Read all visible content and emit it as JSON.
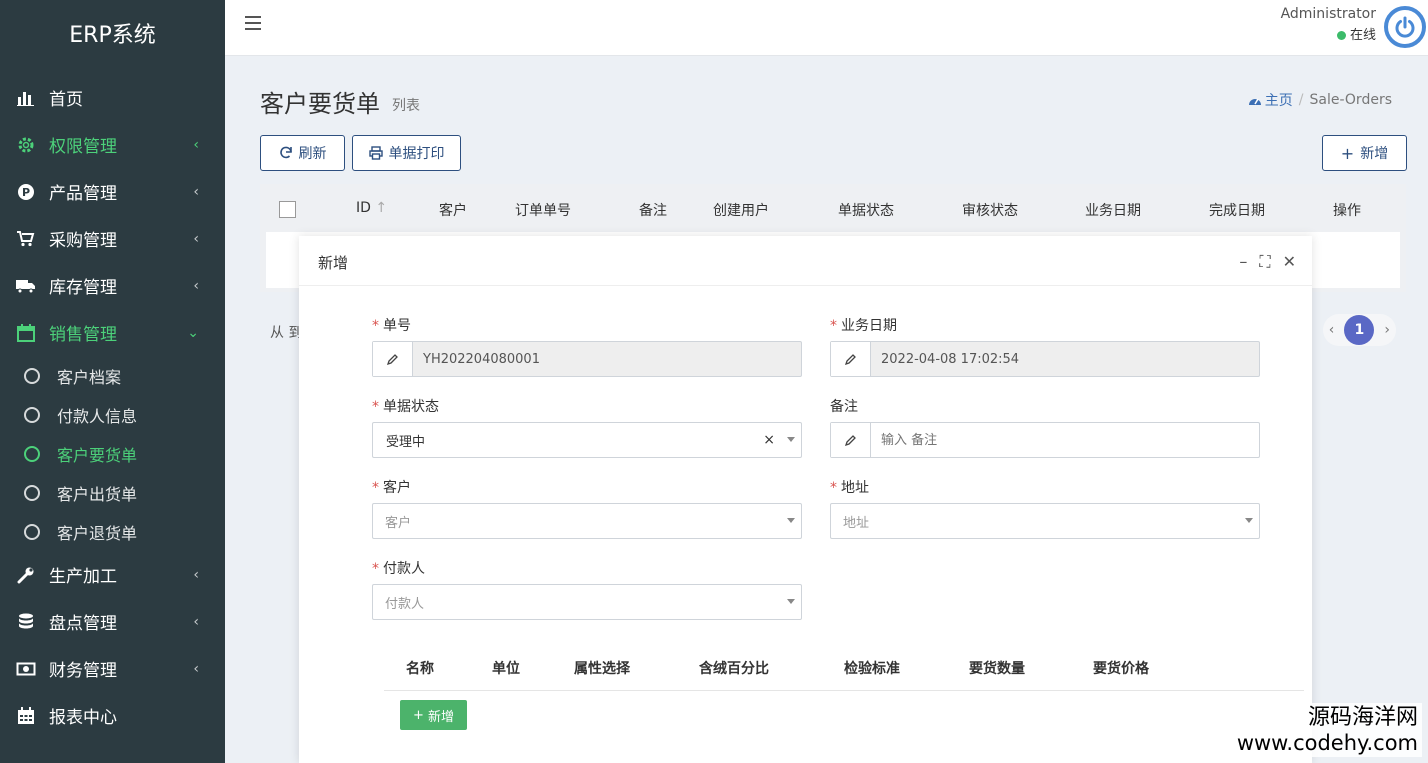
{
  "app": {
    "brand": "ERP系统"
  },
  "sidebar": {
    "items": [
      {
        "label": "首页",
        "icon": "bar-chart-icon",
        "active": false,
        "has_chevron": false
      },
      {
        "label": "权限管理",
        "icon": "gear-icon",
        "active": true,
        "has_chevron": true,
        "chevron": "‹"
      },
      {
        "label": "产品管理",
        "icon": "p-circle-icon",
        "active": false,
        "has_chevron": true,
        "chevron": "‹"
      },
      {
        "label": "采购管理",
        "icon": "cart-icon",
        "active": false,
        "has_chevron": true,
        "chevron": "‹"
      },
      {
        "label": "库存管理",
        "icon": "truck-icon",
        "active": false,
        "has_chevron": true,
        "chevron": "‹"
      },
      {
        "label": "销售管理",
        "icon": "calendar-icon",
        "active": true,
        "has_chevron": true,
        "chevron": "⌄"
      }
    ],
    "sub_items": [
      {
        "label": "客户档案",
        "active": false
      },
      {
        "label": "付款人信息",
        "active": false
      },
      {
        "label": "客户要货单",
        "active": true
      },
      {
        "label": "客户出货单",
        "active": false
      },
      {
        "label": "客户退货单",
        "active": false
      }
    ],
    "items_after": [
      {
        "label": "生产加工",
        "icon": "wrench-icon",
        "chevron": "‹"
      },
      {
        "label": "盘点管理",
        "icon": "database-icon",
        "chevron": "‹"
      },
      {
        "label": "财务管理",
        "icon": "money-icon",
        "chevron": "‹"
      },
      {
        "label": "报表中心",
        "icon": "calendar-grid-icon",
        "chevron": ""
      }
    ],
    "accent_color": "#4cd17a"
  },
  "topbar": {
    "user_name": "Administrator",
    "status": "在线"
  },
  "page": {
    "title": "客户要货单",
    "subtitle": "列表",
    "breadcrumb_home": "主页",
    "breadcrumb_sep": "/",
    "breadcrumb_current": "Sale-Orders"
  },
  "toolbar": {
    "refresh_label": "刷新",
    "print_label": "单据打印",
    "add_label": "新增"
  },
  "table": {
    "columns": [
      "ID",
      "客户",
      "订单单号",
      "备注",
      "创建用户",
      "单据状态",
      "审核状态",
      "业务日期",
      "完成日期",
      "操作"
    ],
    "pager_text": "从 到",
    "current_page": "1"
  },
  "modal": {
    "title": "新增",
    "fields": {
      "order_no_label": "单号",
      "order_no_value": "YH202204080001",
      "biz_date_label": "业务日期",
      "biz_date_value": "2022-04-08 17:02:54",
      "status_label": "单据状态",
      "status_value": "受理中",
      "remark_label": "备注",
      "remark_placeholder": "输入 备注",
      "customer_label": "客户",
      "customer_placeholder": "客户",
      "address_label": "地址",
      "address_placeholder": "地址",
      "payer_label": "付款人",
      "payer_placeholder": "付款人"
    },
    "detail_columns": [
      "名称",
      "单位",
      "属性选择",
      "含绒百分比",
      "检验标准",
      "要货数量",
      "要货价格"
    ],
    "add_row_label": "新增"
  },
  "watermark": {
    "line1": "源码海洋网",
    "line2": "www.codehy.com"
  },
  "colors": {
    "sidebar_bg": "#2c3b41",
    "primary": "#2d4f7f",
    "success": "#4cb36b",
    "pager": "#5a68c5"
  }
}
